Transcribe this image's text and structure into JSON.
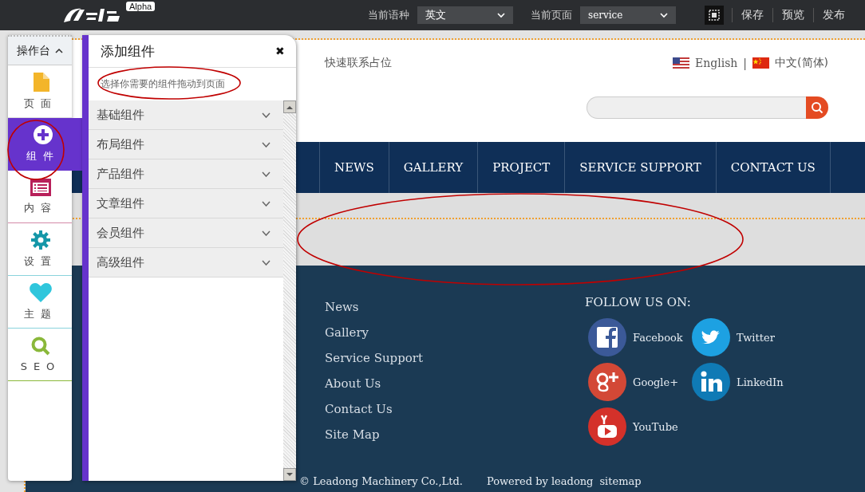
{
  "topbar": {
    "badge": "Alpha",
    "language_label": "当前语种",
    "language_value": "英文",
    "page_label": "当前页面",
    "page_value": "service",
    "actions": [
      "保存",
      "预览",
      "发布"
    ]
  },
  "toolbar": {
    "title": "操作台",
    "items": [
      {
        "label": "页面",
        "kind": "page",
        "selected": false
      },
      {
        "label": "组件",
        "kind": "widget",
        "selected": true
      },
      {
        "label": "内容",
        "kind": "content",
        "selected": false
      },
      {
        "label": "设置",
        "kind": "settings",
        "selected": false
      },
      {
        "label": "主题",
        "kind": "theme",
        "selected": false
      },
      {
        "label": "SEO",
        "kind": "seo",
        "selected": false
      }
    ]
  },
  "panel": {
    "title": "添加组件",
    "close": "✖",
    "hint": "选择你需要的组件拖动到页面",
    "groups": [
      {
        "label": "基础组件",
        "expanded": false
      },
      {
        "label": "布局组件",
        "expanded": false
      },
      {
        "label": "产品组件",
        "expanded": false
      },
      {
        "label": "文章组件",
        "expanded": false
      },
      {
        "label": "会员组件",
        "expanded": false
      },
      {
        "label": "高级组件",
        "expanded": false
      }
    ]
  },
  "site": {
    "quick_contact": "快速联系占位",
    "languages": [
      {
        "label": "English",
        "kind": "us"
      },
      {
        "label": "中文(简体)",
        "kind": "cn"
      }
    ],
    "separator": "|",
    "nav": [
      "NEWS",
      "GALLERY",
      "PROJECT",
      "SERVICE SUPPORT",
      "CONTACT US"
    ],
    "footer_links": [
      "News",
      "Gallery",
      "Service Support",
      "About Us",
      "Contact Us",
      "Site Map"
    ],
    "follow_title": "FOLLOW US ON:",
    "social": [
      {
        "label": "Facebook",
        "kind": "facebook"
      },
      {
        "label": "Twitter",
        "kind": "twitter"
      },
      {
        "label": "Google+",
        "kind": "googleplus"
      },
      {
        "label": "LinkedIn",
        "kind": "linkedin"
      },
      {
        "label": "YouTube",
        "kind": "youtube"
      }
    ],
    "copyright": "© Leadong Machinery Co.,Ltd.",
    "powered": "Powered by leadong",
    "sitemap": "sitemap"
  }
}
